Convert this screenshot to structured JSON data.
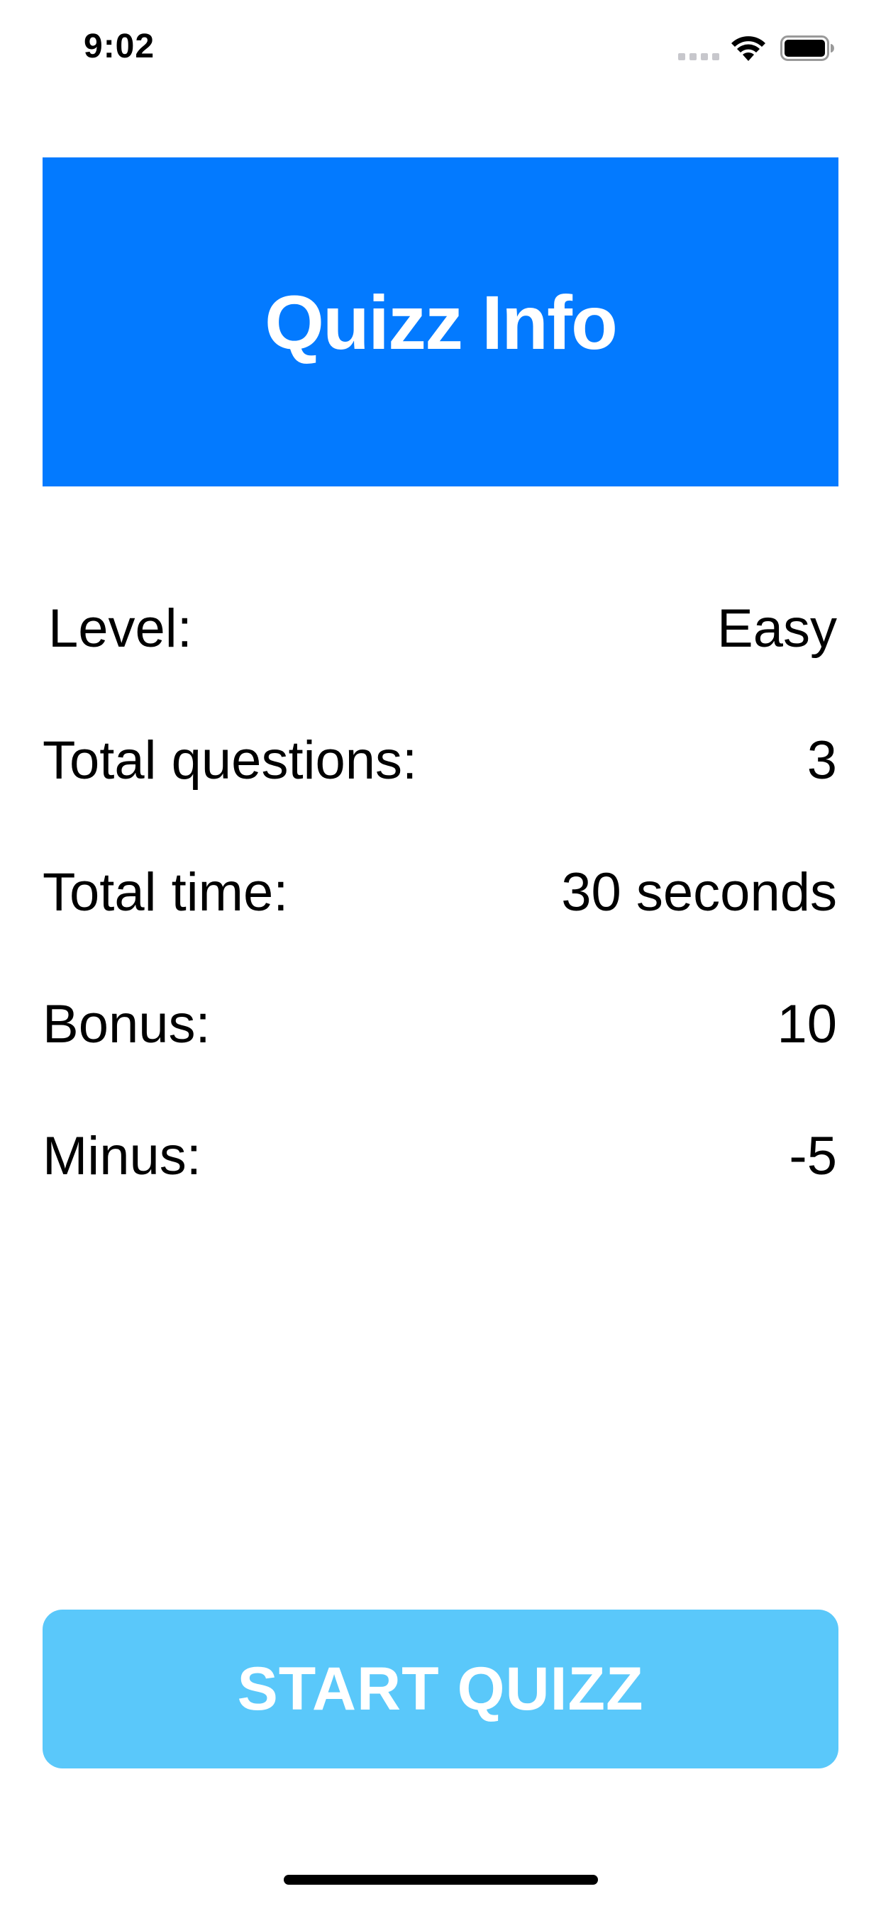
{
  "status_bar": {
    "time": "9:02",
    "icons": [
      "signal-icon",
      "wifi-icon",
      "battery-icon"
    ]
  },
  "header": {
    "title": "Quizz Info"
  },
  "info": {
    "rows": [
      {
        "label": "Level:",
        "value": "Easy"
      },
      {
        "label": "Total questions:",
        "value": "3"
      },
      {
        "label": "Total time:",
        "value": "30 seconds"
      },
      {
        "label": "Bonus:",
        "value": "10"
      },
      {
        "label": "Minus:",
        "value": "-5"
      }
    ]
  },
  "start_button": {
    "label": "START QUIZZ"
  },
  "colors": {
    "header_background": "#037AFF",
    "button_background": "#5AC8FA",
    "text_primary": "#000000",
    "text_on_color": "#FFFFFF"
  }
}
